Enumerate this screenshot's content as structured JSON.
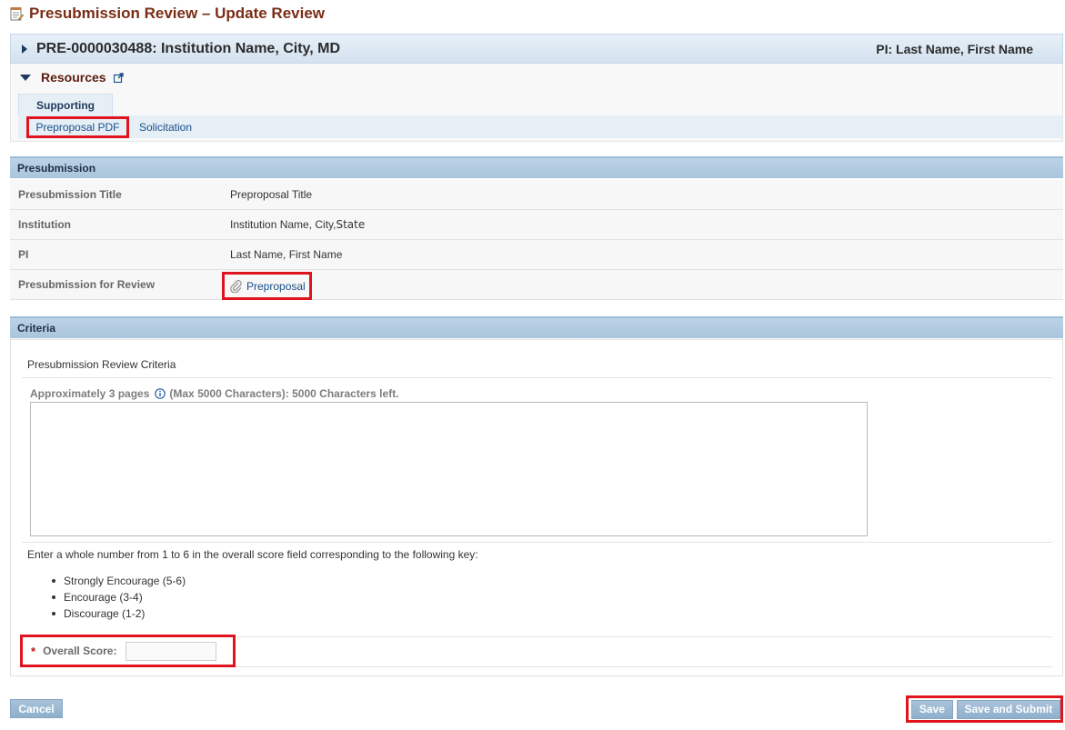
{
  "page": {
    "title": "Presubmission Review – Update Review",
    "title_icon": "notepad-icon"
  },
  "proposal": {
    "id_line": "PRE-0000030488: Institution Name, City, MD",
    "pi_line": "PI: Last Name, First Name"
  },
  "resources": {
    "label": "Resources",
    "tab": "Supporting",
    "links": [
      "Preproposal PDF",
      "Solicitation"
    ]
  },
  "presubmission": {
    "header": "Presubmission",
    "rows": [
      {
        "label": "Presubmission Title",
        "value": "Preproposal Title"
      },
      {
        "label": "Institution",
        "value": "Institution Name, City,"
      },
      {
        "label": "PI",
        "value": "Last Name, First Name"
      },
      {
        "label": "Presubmission for Review",
        "value": "Preproposal"
      }
    ],
    "institution_state": "State"
  },
  "criteria": {
    "header": "Criteria",
    "title": "Presubmission Review Criteria",
    "approx_prefix": "Approximately 3 pages",
    "approx_suffix": "(Max 5000 Characters): 5000 Characters left.",
    "textarea_value": "",
    "key_intro": "Enter a whole number from 1 to 6 in the overall score field corresponding to the following key:",
    "key_items": [
      "Strongly Encourage (5-6)",
      "Encourage (3-4)",
      "Discourage (1-2)"
    ],
    "score_label": "Overall Score:",
    "score_value": ""
  },
  "buttons": {
    "cancel": "Cancel",
    "save": "Save",
    "save_submit": "Save and Submit"
  },
  "colors": {
    "title": "#7a2d16",
    "highlight": "#e0141e",
    "link": "#1a4f8a",
    "button": "#9db9d3"
  }
}
